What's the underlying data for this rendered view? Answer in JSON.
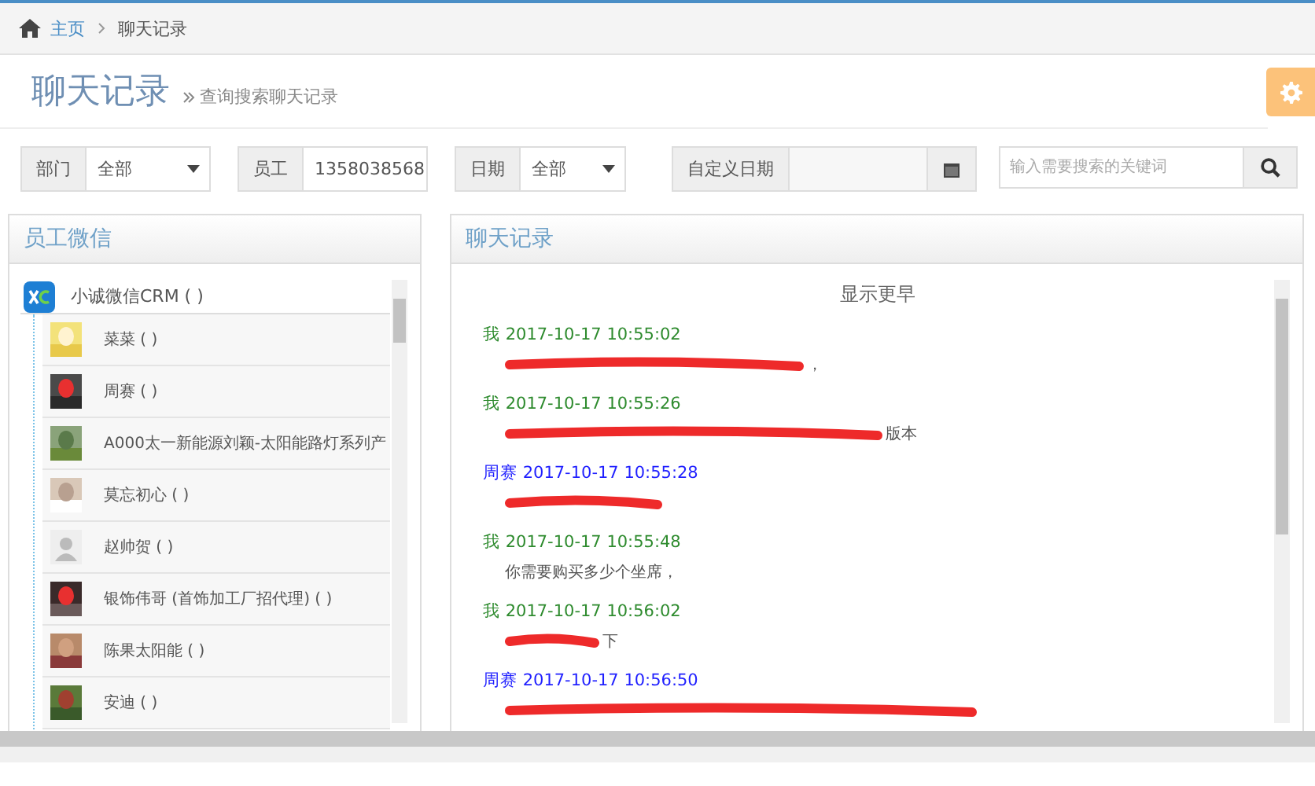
{
  "breadcrumb": [
    {
      "label": "主页"
    },
    {
      "label": "聊天记录"
    }
  ],
  "page_header": {
    "title": "聊天记录",
    "subtitle": "查询搜索聊天记录"
  },
  "filters": [
    {
      "kind": "select",
      "label": "部门",
      "value": "全部"
    },
    {
      "kind": "select",
      "label": "员工",
      "value": "1358038568"
    },
    {
      "kind": "select",
      "label": "日期",
      "value": "全部"
    },
    {
      "kind": "date",
      "label": "自定义日期"
    },
    {
      "kind": "search",
      "placeholder": "输入需要搜索的关键词"
    }
  ],
  "staff_panel": {
    "title": "员工微信",
    "group": {
      "label": "小诚微信CRM ( )",
      "children": [
        {
          "name": "菜菜 ( )",
          "kind": "picture"
        },
        {
          "name": "周赛 ( )",
          "kind": "picture"
        },
        {
          "name": "A000太一新能源刘颖-太阳能路灯系列产",
          "kind": "picture"
        },
        {
          "name": "莫忘初心 ( )",
          "kind": "picture"
        },
        {
          "name": "赵帅贺 ( )",
          "kind": "default"
        },
        {
          "name": "银饰伟哥 (首饰加工厂招代理) ( )",
          "kind": "picture"
        },
        {
          "name": "陈果太阳能 ( )",
          "kind": "picture"
        },
        {
          "name": "安迪 ( )",
          "kind": "picture"
        }
      ]
    }
  },
  "chat_panel": {
    "title": "聊天记录",
    "load_more": "显示更早",
    "messages": [
      {
        "sender": "我",
        "time": "2017-10-17 10:55:02",
        "color": "#2e8b2e",
        "redacted": true,
        "text": "，"
      },
      {
        "sender": "我",
        "time": "2017-10-17 10:55:26",
        "color": "#2e8b2e",
        "redacted": true,
        "text": "版本"
      },
      {
        "sender": "周赛",
        "time": "2017-10-17 10:55:28",
        "color": "#1f1fff",
        "redacted": true
      },
      {
        "sender": "我",
        "time": "2017-10-17 10:55:48",
        "color": "#2e8b2e",
        "redacted": false,
        "text": "你需要购买多少个坐席，"
      },
      {
        "sender": "我",
        "time": "2017-10-17 10:56:02",
        "color": "#2e8b2e",
        "redacted": true,
        "text": "下"
      },
      {
        "sender": "周赛",
        "time": "2017-10-17 10:56:50",
        "color": "#1f1fff",
        "redacted": true
      }
    ]
  }
}
